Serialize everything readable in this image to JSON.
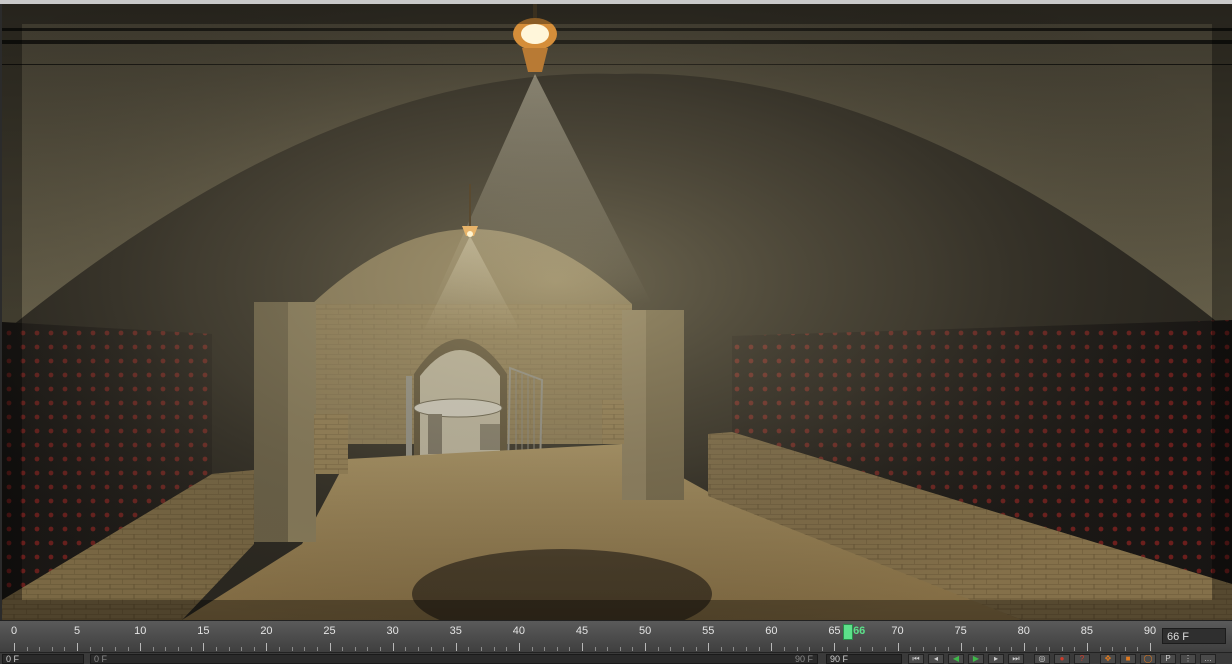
{
  "timeline": {
    "ticks": [
      "0",
      "5",
      "10",
      "15",
      "20",
      "25",
      "30",
      "35",
      "40",
      "45",
      "50",
      "55",
      "60",
      "65",
      "70",
      "75",
      "80",
      "85",
      "90"
    ],
    "current_frame": "66",
    "frame_display": "66 F"
  },
  "controls": {
    "start_frame": "0 F",
    "range_start": "0 F",
    "range_end": "90 F",
    "end_frame": "90 F"
  },
  "colors": {
    "playhead": "#5ce08a",
    "record_button": "#d03a2a",
    "play_button": "#3fb84a",
    "keyframe_button": "#e07a20"
  },
  "icons": {
    "first_frame": "skip-back-icon",
    "prev_key": "prev-key-icon",
    "play_reverse": "play-reverse-icon",
    "play": "play-icon",
    "next_key": "next-key-icon",
    "last_frame": "skip-forward-icon",
    "record": "record-icon",
    "autokey": "autokey-icon",
    "move_key": "move-key-icon",
    "key": "key-icon",
    "rotate": "rotate-key-icon",
    "param": "param-key-icon"
  }
}
